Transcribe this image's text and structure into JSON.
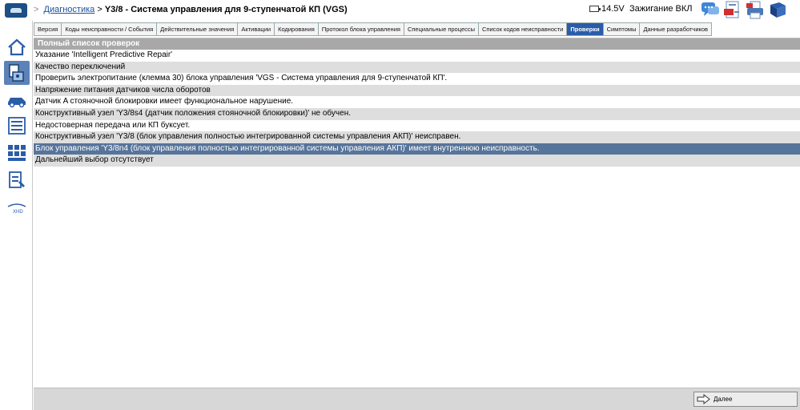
{
  "breadcrumb": {
    "link": "Диагностика",
    "separator": ">",
    "current": "Y3/8 - Система управления для 9-ступенчатой КП (VGS)"
  },
  "status": {
    "voltage": "14.5V",
    "ignition": "Зажигание ВКЛ"
  },
  "top_icons": [
    "chat-icon",
    "pdf-document-icon",
    "pdf-print-icon",
    "help-book-icon"
  ],
  "sidebar": {
    "items": [
      {
        "name": "home-icon",
        "active": false
      },
      {
        "name": "control-unit-icon",
        "active": true
      },
      {
        "name": "vehicle-icon",
        "active": false
      },
      {
        "name": "list-icon",
        "active": false
      },
      {
        "name": "grid-modules-icon",
        "active": false
      },
      {
        "name": "document-tools-icon",
        "active": false
      },
      {
        "name": "xhd-icon",
        "active": false
      }
    ]
  },
  "tabs": [
    {
      "label": "Версия",
      "active": false
    },
    {
      "label": "Коды неисправности / События",
      "active": false
    },
    {
      "label": "Действительные значения",
      "active": false
    },
    {
      "label": "Активации",
      "active": false
    },
    {
      "label": "Кодирования",
      "active": false
    },
    {
      "label": "Протокол блока управления",
      "active": false
    },
    {
      "label": "Специальные процессы",
      "active": false
    },
    {
      "label": "Список кодов неисправности",
      "active": false
    },
    {
      "label": "Проверки",
      "active": true
    },
    {
      "label": "Симптомы",
      "active": false
    },
    {
      "label": "Данные разработчиков",
      "active": false
    }
  ],
  "list": {
    "header": "Полный список проверок",
    "selected_index": 9,
    "items": [
      "Указание 'Intelligent Predictive Repair'",
      "Качество переключений",
      "Проверить электропитание (клемма 30) блока управления 'VGS - Система управления для 9-ступенчатой КП'.",
      "Напряжение питания датчиков числа оборотов",
      "Датчик A стояночной блокировки имеет функциональное нарушение.",
      "Конструктивный узел 'Y3/8s4 (датчик положения стояночной блокировки)' не обучен.",
      "Недостоверная передача или КП буксует.",
      "Конструктивный узел 'Y3/8 (блок управления полностью интегрированной системы управления АКП)' неисправен.",
      "Блок управления 'Y3/8n4 (блок управления полностью интегрированной системы управления АКП)' имеет внутреннюю неисправность.",
      "Дальнейший выбор отсутствует"
    ]
  },
  "footer": {
    "next_label": "Далее"
  },
  "colors": {
    "active_tab": "#2a5da8",
    "selected_row": "#57749a",
    "header_bg": "#a8a8a8",
    "sidebar_active": "#5c82b7"
  }
}
